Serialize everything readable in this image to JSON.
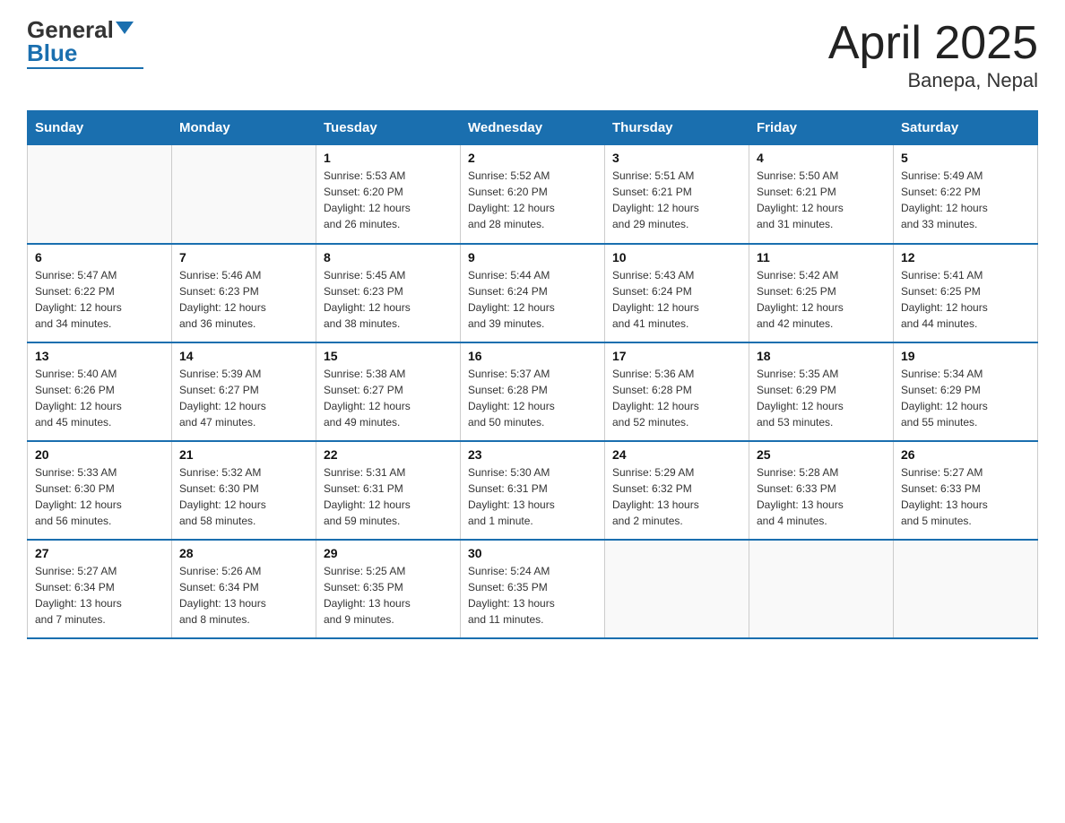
{
  "header": {
    "logo_general": "General",
    "logo_blue": "Blue",
    "title": "April 2025",
    "subtitle": "Banepa, Nepal"
  },
  "days_of_week": [
    "Sunday",
    "Monday",
    "Tuesday",
    "Wednesday",
    "Thursday",
    "Friday",
    "Saturday"
  ],
  "weeks": [
    [
      {
        "day": "",
        "info": ""
      },
      {
        "day": "",
        "info": ""
      },
      {
        "day": "1",
        "info": "Sunrise: 5:53 AM\nSunset: 6:20 PM\nDaylight: 12 hours\nand 26 minutes."
      },
      {
        "day": "2",
        "info": "Sunrise: 5:52 AM\nSunset: 6:20 PM\nDaylight: 12 hours\nand 28 minutes."
      },
      {
        "day": "3",
        "info": "Sunrise: 5:51 AM\nSunset: 6:21 PM\nDaylight: 12 hours\nand 29 minutes."
      },
      {
        "day": "4",
        "info": "Sunrise: 5:50 AM\nSunset: 6:21 PM\nDaylight: 12 hours\nand 31 minutes."
      },
      {
        "day": "5",
        "info": "Sunrise: 5:49 AM\nSunset: 6:22 PM\nDaylight: 12 hours\nand 33 minutes."
      }
    ],
    [
      {
        "day": "6",
        "info": "Sunrise: 5:47 AM\nSunset: 6:22 PM\nDaylight: 12 hours\nand 34 minutes."
      },
      {
        "day": "7",
        "info": "Sunrise: 5:46 AM\nSunset: 6:23 PM\nDaylight: 12 hours\nand 36 minutes."
      },
      {
        "day": "8",
        "info": "Sunrise: 5:45 AM\nSunset: 6:23 PM\nDaylight: 12 hours\nand 38 minutes."
      },
      {
        "day": "9",
        "info": "Sunrise: 5:44 AM\nSunset: 6:24 PM\nDaylight: 12 hours\nand 39 minutes."
      },
      {
        "day": "10",
        "info": "Sunrise: 5:43 AM\nSunset: 6:24 PM\nDaylight: 12 hours\nand 41 minutes."
      },
      {
        "day": "11",
        "info": "Sunrise: 5:42 AM\nSunset: 6:25 PM\nDaylight: 12 hours\nand 42 minutes."
      },
      {
        "day": "12",
        "info": "Sunrise: 5:41 AM\nSunset: 6:25 PM\nDaylight: 12 hours\nand 44 minutes."
      }
    ],
    [
      {
        "day": "13",
        "info": "Sunrise: 5:40 AM\nSunset: 6:26 PM\nDaylight: 12 hours\nand 45 minutes."
      },
      {
        "day": "14",
        "info": "Sunrise: 5:39 AM\nSunset: 6:27 PM\nDaylight: 12 hours\nand 47 minutes."
      },
      {
        "day": "15",
        "info": "Sunrise: 5:38 AM\nSunset: 6:27 PM\nDaylight: 12 hours\nand 49 minutes."
      },
      {
        "day": "16",
        "info": "Sunrise: 5:37 AM\nSunset: 6:28 PM\nDaylight: 12 hours\nand 50 minutes."
      },
      {
        "day": "17",
        "info": "Sunrise: 5:36 AM\nSunset: 6:28 PM\nDaylight: 12 hours\nand 52 minutes."
      },
      {
        "day": "18",
        "info": "Sunrise: 5:35 AM\nSunset: 6:29 PM\nDaylight: 12 hours\nand 53 minutes."
      },
      {
        "day": "19",
        "info": "Sunrise: 5:34 AM\nSunset: 6:29 PM\nDaylight: 12 hours\nand 55 minutes."
      }
    ],
    [
      {
        "day": "20",
        "info": "Sunrise: 5:33 AM\nSunset: 6:30 PM\nDaylight: 12 hours\nand 56 minutes."
      },
      {
        "day": "21",
        "info": "Sunrise: 5:32 AM\nSunset: 6:30 PM\nDaylight: 12 hours\nand 58 minutes."
      },
      {
        "day": "22",
        "info": "Sunrise: 5:31 AM\nSunset: 6:31 PM\nDaylight: 12 hours\nand 59 minutes."
      },
      {
        "day": "23",
        "info": "Sunrise: 5:30 AM\nSunset: 6:31 PM\nDaylight: 13 hours\nand 1 minute."
      },
      {
        "day": "24",
        "info": "Sunrise: 5:29 AM\nSunset: 6:32 PM\nDaylight: 13 hours\nand 2 minutes."
      },
      {
        "day": "25",
        "info": "Sunrise: 5:28 AM\nSunset: 6:33 PM\nDaylight: 13 hours\nand 4 minutes."
      },
      {
        "day": "26",
        "info": "Sunrise: 5:27 AM\nSunset: 6:33 PM\nDaylight: 13 hours\nand 5 minutes."
      }
    ],
    [
      {
        "day": "27",
        "info": "Sunrise: 5:27 AM\nSunset: 6:34 PM\nDaylight: 13 hours\nand 7 minutes."
      },
      {
        "day": "28",
        "info": "Sunrise: 5:26 AM\nSunset: 6:34 PM\nDaylight: 13 hours\nand 8 minutes."
      },
      {
        "day": "29",
        "info": "Sunrise: 5:25 AM\nSunset: 6:35 PM\nDaylight: 13 hours\nand 9 minutes."
      },
      {
        "day": "30",
        "info": "Sunrise: 5:24 AM\nSunset: 6:35 PM\nDaylight: 13 hours\nand 11 minutes."
      },
      {
        "day": "",
        "info": ""
      },
      {
        "day": "",
        "info": ""
      },
      {
        "day": "",
        "info": ""
      }
    ]
  ]
}
